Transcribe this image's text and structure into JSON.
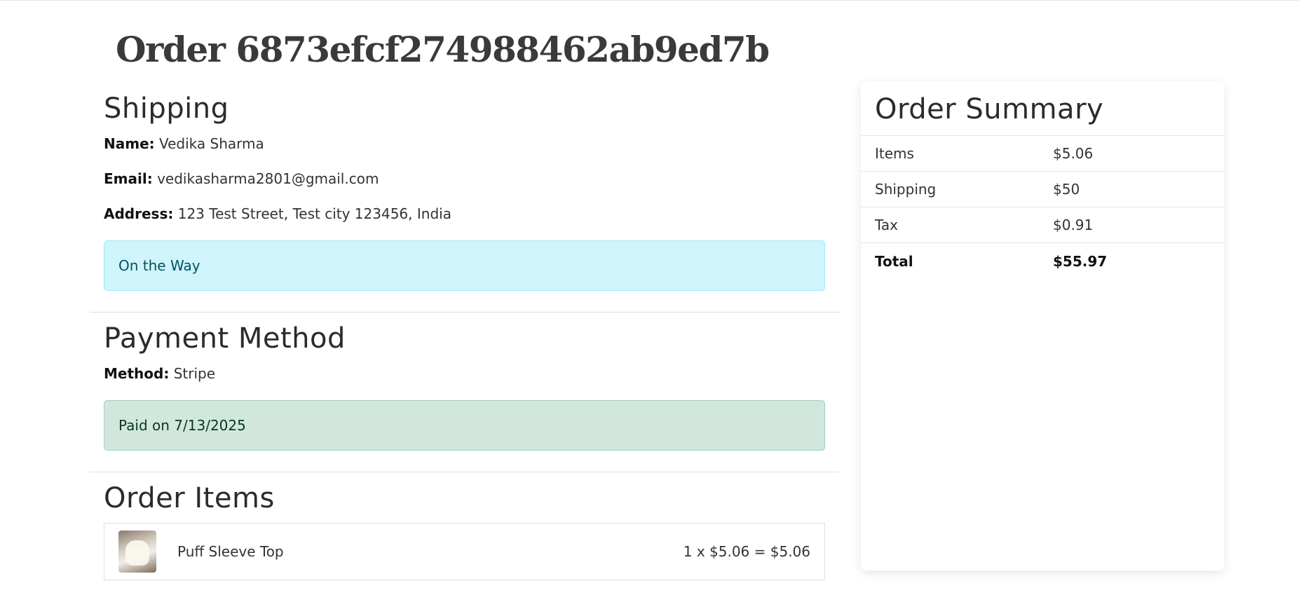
{
  "order": {
    "title": "Order 6873efcf274988462ab9ed7b"
  },
  "shipping": {
    "heading": "Shipping",
    "name_label": "Name:",
    "name_value": "Vedika Sharma",
    "email_label": "Email:",
    "email_value": "vedikasharma2801@gmail.com",
    "address_label": "Address:",
    "address_value": "123 Test Street, Test city 123456, India",
    "status": "On the Way"
  },
  "payment": {
    "heading": "Payment Method",
    "method_label": "Method:",
    "method_value": "Stripe",
    "status": "Paid on 7/13/2025"
  },
  "items": {
    "heading": "Order Items",
    "list": [
      {
        "name": "Puff Sleeve Top",
        "calc": "1 x $5.06 = $5.06",
        "image_icon": "product-thumbnail"
      }
    ]
  },
  "summary": {
    "heading": "Order Summary",
    "rows": [
      {
        "label": "Items",
        "value": "$5.06"
      },
      {
        "label": "Shipping",
        "value": "$50"
      },
      {
        "label": "Tax",
        "value": "$0.91"
      }
    ],
    "total_label": "Total",
    "total_value": "$55.97"
  }
}
